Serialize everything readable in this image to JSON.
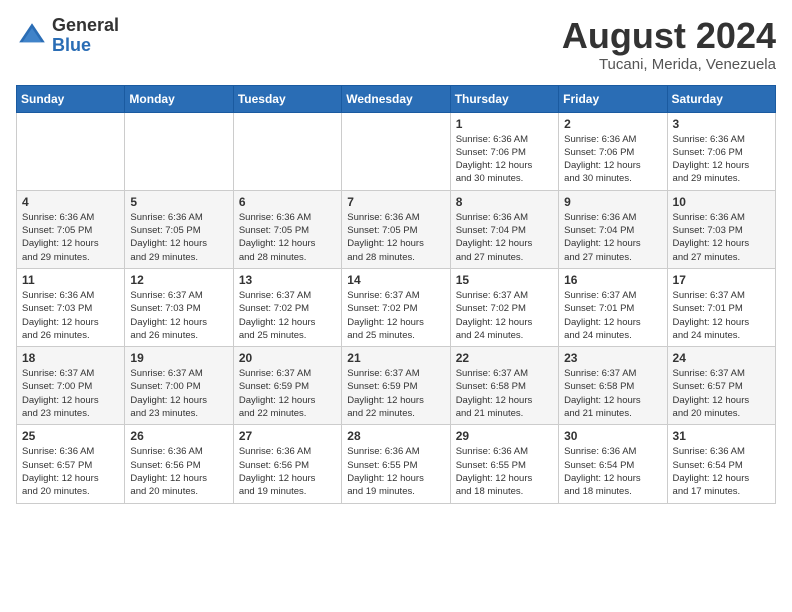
{
  "header": {
    "logo": {
      "general": "General",
      "blue": "Blue"
    },
    "title": "August 2024",
    "location": "Tucani, Merida, Venezuela"
  },
  "weekdays": [
    "Sunday",
    "Monday",
    "Tuesday",
    "Wednesday",
    "Thursday",
    "Friday",
    "Saturday"
  ],
  "weeks": [
    [
      {
        "day": "",
        "info": ""
      },
      {
        "day": "",
        "info": ""
      },
      {
        "day": "",
        "info": ""
      },
      {
        "day": "",
        "info": ""
      },
      {
        "day": "1",
        "info": "Sunrise: 6:36 AM\nSunset: 7:06 PM\nDaylight: 12 hours\nand 30 minutes."
      },
      {
        "day": "2",
        "info": "Sunrise: 6:36 AM\nSunset: 7:06 PM\nDaylight: 12 hours\nand 30 minutes."
      },
      {
        "day": "3",
        "info": "Sunrise: 6:36 AM\nSunset: 7:06 PM\nDaylight: 12 hours\nand 29 minutes."
      }
    ],
    [
      {
        "day": "4",
        "info": "Sunrise: 6:36 AM\nSunset: 7:05 PM\nDaylight: 12 hours\nand 29 minutes."
      },
      {
        "day": "5",
        "info": "Sunrise: 6:36 AM\nSunset: 7:05 PM\nDaylight: 12 hours\nand 29 minutes."
      },
      {
        "day": "6",
        "info": "Sunrise: 6:36 AM\nSunset: 7:05 PM\nDaylight: 12 hours\nand 28 minutes."
      },
      {
        "day": "7",
        "info": "Sunrise: 6:36 AM\nSunset: 7:05 PM\nDaylight: 12 hours\nand 28 minutes."
      },
      {
        "day": "8",
        "info": "Sunrise: 6:36 AM\nSunset: 7:04 PM\nDaylight: 12 hours\nand 27 minutes."
      },
      {
        "day": "9",
        "info": "Sunrise: 6:36 AM\nSunset: 7:04 PM\nDaylight: 12 hours\nand 27 minutes."
      },
      {
        "day": "10",
        "info": "Sunrise: 6:36 AM\nSunset: 7:03 PM\nDaylight: 12 hours\nand 27 minutes."
      }
    ],
    [
      {
        "day": "11",
        "info": "Sunrise: 6:36 AM\nSunset: 7:03 PM\nDaylight: 12 hours\nand 26 minutes."
      },
      {
        "day": "12",
        "info": "Sunrise: 6:37 AM\nSunset: 7:03 PM\nDaylight: 12 hours\nand 26 minutes."
      },
      {
        "day": "13",
        "info": "Sunrise: 6:37 AM\nSunset: 7:02 PM\nDaylight: 12 hours\nand 25 minutes."
      },
      {
        "day": "14",
        "info": "Sunrise: 6:37 AM\nSunset: 7:02 PM\nDaylight: 12 hours\nand 25 minutes."
      },
      {
        "day": "15",
        "info": "Sunrise: 6:37 AM\nSunset: 7:02 PM\nDaylight: 12 hours\nand 24 minutes."
      },
      {
        "day": "16",
        "info": "Sunrise: 6:37 AM\nSunset: 7:01 PM\nDaylight: 12 hours\nand 24 minutes."
      },
      {
        "day": "17",
        "info": "Sunrise: 6:37 AM\nSunset: 7:01 PM\nDaylight: 12 hours\nand 24 minutes."
      }
    ],
    [
      {
        "day": "18",
        "info": "Sunrise: 6:37 AM\nSunset: 7:00 PM\nDaylight: 12 hours\nand 23 minutes."
      },
      {
        "day": "19",
        "info": "Sunrise: 6:37 AM\nSunset: 7:00 PM\nDaylight: 12 hours\nand 23 minutes."
      },
      {
        "day": "20",
        "info": "Sunrise: 6:37 AM\nSunset: 6:59 PM\nDaylight: 12 hours\nand 22 minutes."
      },
      {
        "day": "21",
        "info": "Sunrise: 6:37 AM\nSunset: 6:59 PM\nDaylight: 12 hours\nand 22 minutes."
      },
      {
        "day": "22",
        "info": "Sunrise: 6:37 AM\nSunset: 6:58 PM\nDaylight: 12 hours\nand 21 minutes."
      },
      {
        "day": "23",
        "info": "Sunrise: 6:37 AM\nSunset: 6:58 PM\nDaylight: 12 hours\nand 21 minutes."
      },
      {
        "day": "24",
        "info": "Sunrise: 6:37 AM\nSunset: 6:57 PM\nDaylight: 12 hours\nand 20 minutes."
      }
    ],
    [
      {
        "day": "25",
        "info": "Sunrise: 6:36 AM\nSunset: 6:57 PM\nDaylight: 12 hours\nand 20 minutes."
      },
      {
        "day": "26",
        "info": "Sunrise: 6:36 AM\nSunset: 6:56 PM\nDaylight: 12 hours\nand 20 minutes."
      },
      {
        "day": "27",
        "info": "Sunrise: 6:36 AM\nSunset: 6:56 PM\nDaylight: 12 hours\nand 19 minutes."
      },
      {
        "day": "28",
        "info": "Sunrise: 6:36 AM\nSunset: 6:55 PM\nDaylight: 12 hours\nand 19 minutes."
      },
      {
        "day": "29",
        "info": "Sunrise: 6:36 AM\nSunset: 6:55 PM\nDaylight: 12 hours\nand 18 minutes."
      },
      {
        "day": "30",
        "info": "Sunrise: 6:36 AM\nSunset: 6:54 PM\nDaylight: 12 hours\nand 18 minutes."
      },
      {
        "day": "31",
        "info": "Sunrise: 6:36 AM\nSunset: 6:54 PM\nDaylight: 12 hours\nand 17 minutes."
      }
    ]
  ]
}
